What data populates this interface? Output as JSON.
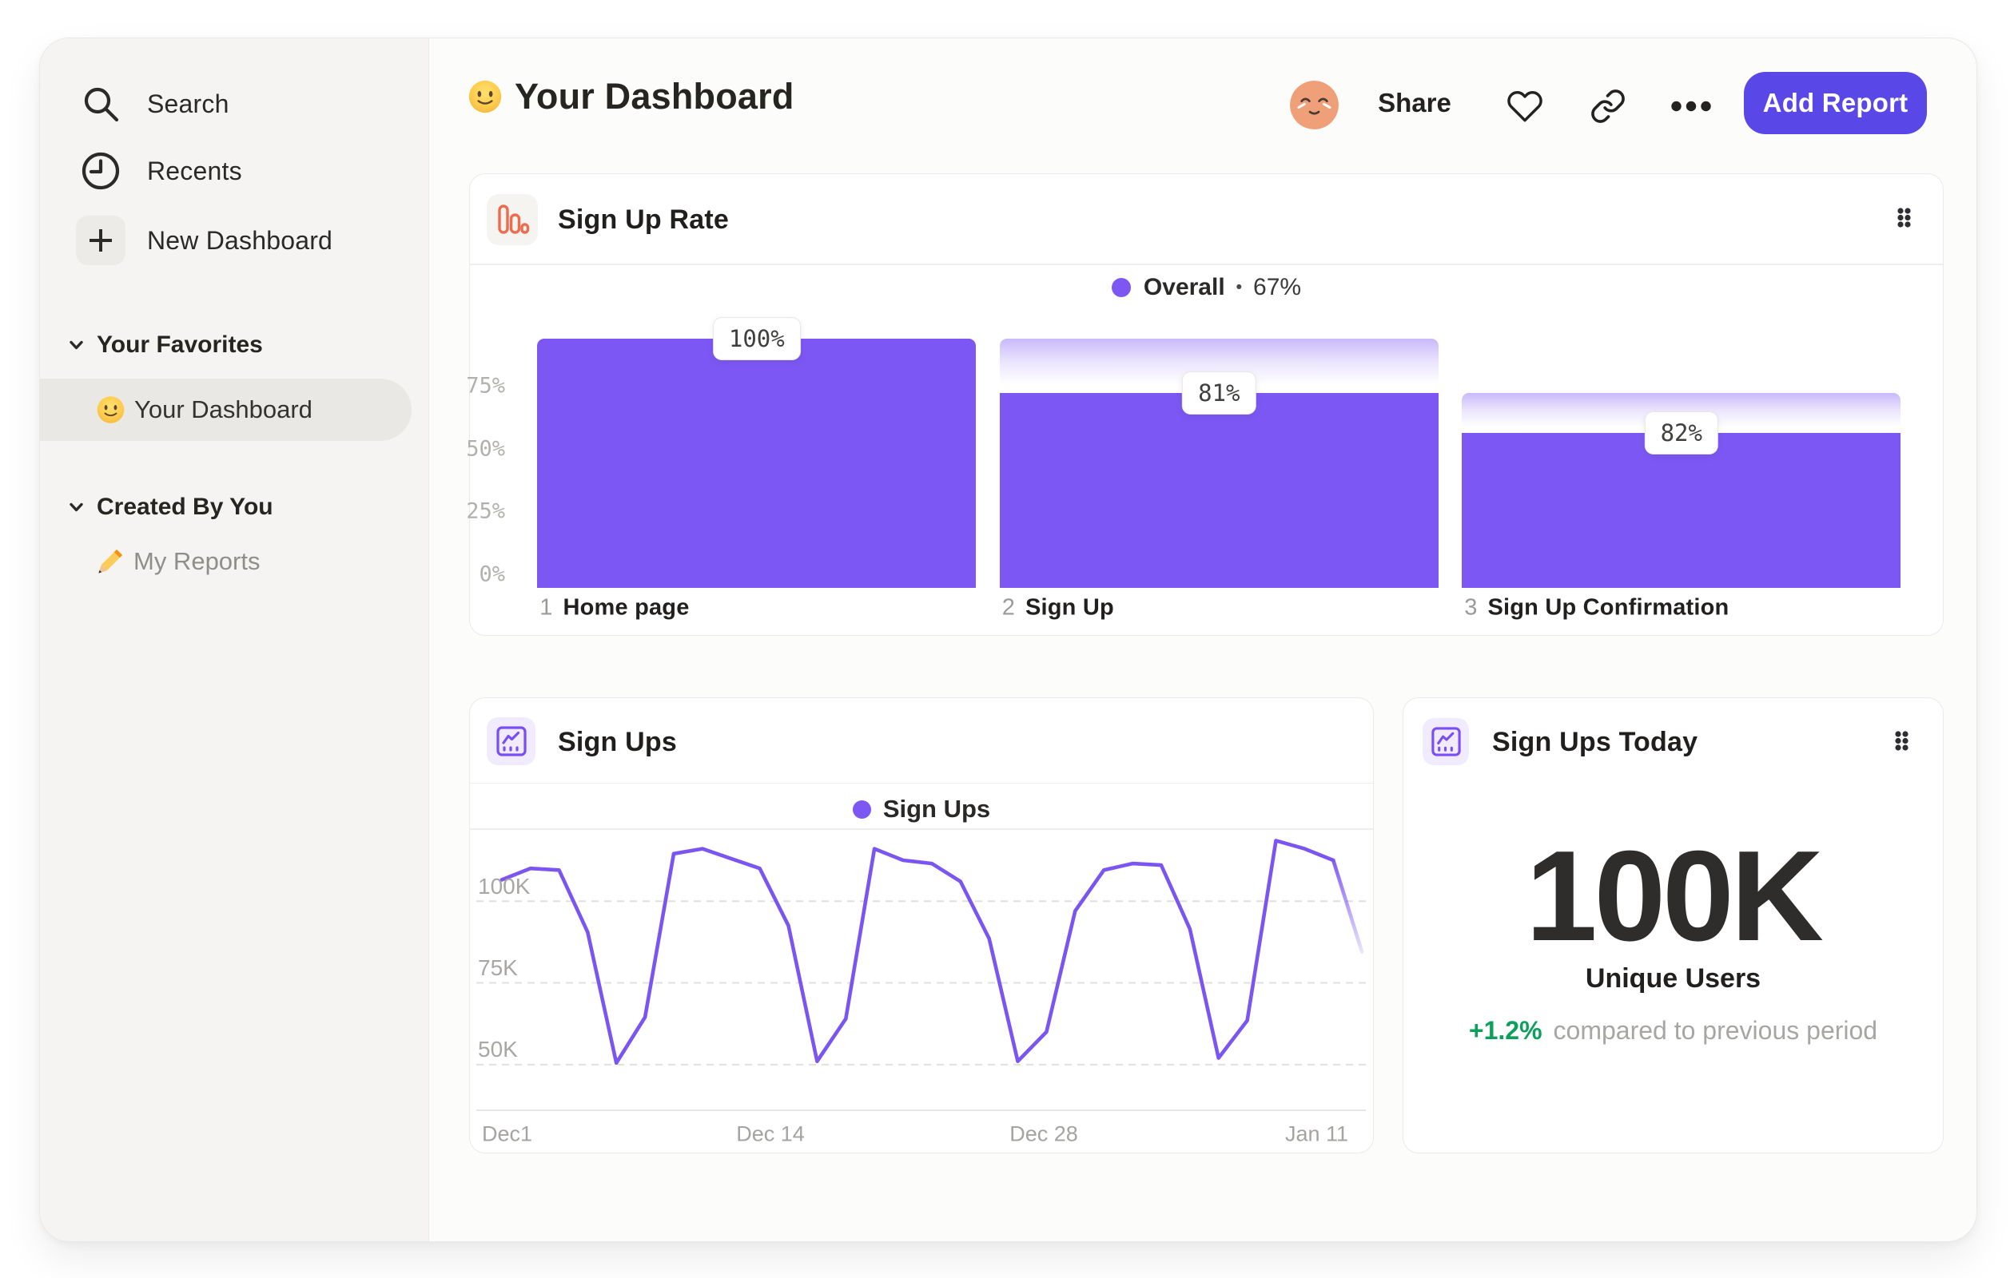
{
  "window": {
    "outer_bg": "#FFFFFF",
    "bg": "#FCFCFB",
    "sidebar_bg": "#F5F4F2"
  },
  "colors": {
    "accent_purple": "#7D57F3",
    "button_indigo": "#5A47E8",
    "icon_orange": "#EE6C4D",
    "delta_green": "#0CA05C"
  },
  "sidebar": {
    "nav": [
      {
        "label": "Search",
        "icon": "search-icon"
      },
      {
        "label": "Recents",
        "icon": "clock-icon"
      },
      {
        "label": "New Dashboard",
        "icon": "plus-icon"
      }
    ],
    "sections": [
      {
        "label": "Your Favorites",
        "items": [
          {
            "emoji": "slightly-smiling-face",
            "label": "Your Dashboard",
            "selected": true
          }
        ]
      },
      {
        "label": "Created By You",
        "items": [
          {
            "emoji": "pencil",
            "label": "My Reports",
            "selected": false
          }
        ]
      }
    ]
  },
  "header": {
    "emoji": "slightly-smiling-face",
    "title": "Your Dashboard",
    "share_label": "Share",
    "add_report_label": "Add Report",
    "icons": [
      "avatar",
      "heart-icon",
      "link-icon",
      "ellipsis-icon"
    ]
  },
  "chart_data": [
    {
      "id": "signup-rate",
      "type": "bar",
      "variant": "funnel",
      "title": "Sign Up Rate",
      "legend": {
        "series": "Overall",
        "separator": "•",
        "value": "67%",
        "position": "top-center"
      },
      "categories": [
        "Home page",
        "Sign Up",
        "Sign Up Confirmation"
      ],
      "step_numbers": [
        "1",
        "2",
        "3"
      ],
      "conversion_labels": [
        "100%",
        "81%",
        "82%"
      ],
      "values_pct_of_previous": [
        100,
        81,
        82
      ],
      "overall_conversion_pct": 67,
      "drawn_cumulative_pct": [
        100,
        78.3,
        62.1
      ],
      "yticks": [
        "0%",
        "25%",
        "50%",
        "75%"
      ],
      "ylim": [
        0,
        100
      ],
      "grid": false
    },
    {
      "id": "signups",
      "type": "line",
      "title": "Sign Ups",
      "legend": {
        "series": "Sign Ups",
        "position": "top-center"
      },
      "yticks": [
        {
          "label": "100K",
          "value": 100
        },
        {
          "label": "75K",
          "value": 75
        },
        {
          "label": "50K",
          "value": 50
        }
      ],
      "xticks": [
        "Dec1",
        "Dec 14",
        "Dec 28",
        "Jan 11"
      ],
      "unit": "K",
      "values_k": [
        102,
        105.5,
        105,
        86,
        46,
        60,
        110,
        111.5,
        108.5,
        105.5,
        88,
        46.5,
        59.5,
        111.5,
        108,
        107,
        101.5,
        84,
        46.5,
        55.5,
        92.5,
        105,
        107,
        106.5,
        87,
        47.5,
        59,
        114,
        111.5,
        108,
        80
      ],
      "tail_fade_points": 1,
      "grid": "dashed-horizontal",
      "ylim_drawn": [
        31.5,
        117
      ]
    },
    {
      "id": "signups-today",
      "type": "stat",
      "title": "Sign Ups Today",
      "value": "100K",
      "label": "Unique Users",
      "delta": "+1.2%",
      "delta_note": "compared to previous period",
      "delta_positive": true
    }
  ]
}
